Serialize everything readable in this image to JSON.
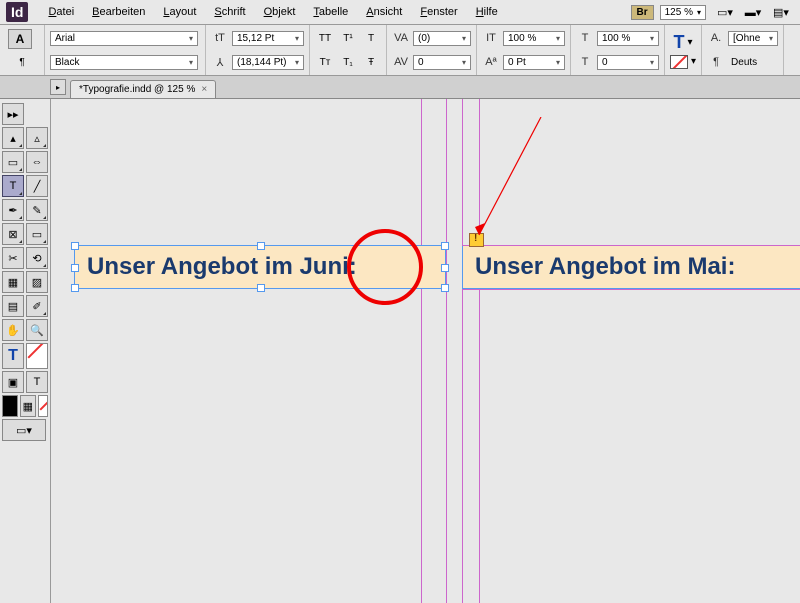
{
  "menu": {
    "items": [
      "Datei",
      "Bearbeiten",
      "Layout",
      "Schrift",
      "Objekt",
      "Tabelle",
      "Ansicht",
      "Fenster",
      "Hilfe"
    ],
    "br": "Br",
    "zoom": "125 %"
  },
  "control": {
    "font": "Arial",
    "weight": "Black",
    "sizeIcon": "tT",
    "size": "15,12 Pt",
    "leadIcon": "⅄",
    "leading": "(18,144 Pt)",
    "ttRow1": [
      "TT",
      "T¹",
      "T"
    ],
    "ttRow2": [
      "Tт",
      "T₁",
      "Ŧ"
    ],
    "vaIcon": "VA",
    "va": "(0)",
    "avIcon": "AV",
    "av": "0",
    "itIcon": "IT",
    "it": "100 %",
    "tIcon": "T",
    "t": "100 %",
    "aaIcon": "Aª",
    "aa": "0 Pt",
    "t2Icon": "T",
    "t2": "0",
    "bigT": "T",
    "pilcrow": "¶",
    "styleA": "A.",
    "style": "[Ohne",
    "lang": "Deuts"
  },
  "tab": {
    "title": "*Typografie.indd @ 125 %"
  },
  "doc": {
    "left": "Unser Angebot im Juni:",
    "right": "Unser Angebot im Mai:"
  }
}
